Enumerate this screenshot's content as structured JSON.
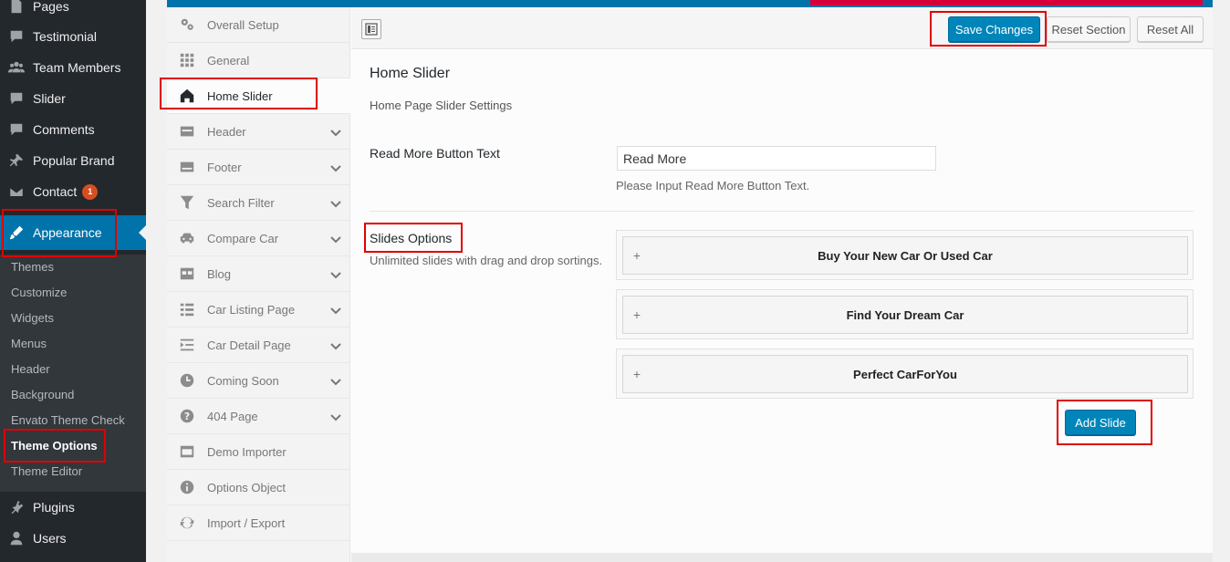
{
  "wp_menu": {
    "items": [
      {
        "label": "Pages",
        "icon": "pages-icon"
      },
      {
        "label": "Testimonial",
        "icon": "comment-icon"
      },
      {
        "label": "Team Members",
        "icon": "users-group-icon"
      },
      {
        "label": "Slider",
        "icon": "comment-icon"
      },
      {
        "label": "Comments",
        "icon": "comments-icon"
      },
      {
        "label": "Popular Brand",
        "icon": "pin-icon"
      },
      {
        "label": "Contact",
        "icon": "envelope-icon",
        "badge": "1"
      }
    ],
    "appearance": "Appearance",
    "submenu": [
      "Themes",
      "Customize",
      "Widgets",
      "Menus",
      "Header",
      "Background",
      "Envato Theme Check",
      "Theme Options",
      "Theme Editor"
    ],
    "bottom_items": [
      {
        "label": "Plugins",
        "icon": "plugin-icon"
      },
      {
        "label": "Users",
        "icon": "user-icon"
      }
    ]
  },
  "panel_nav": [
    {
      "label": "Overall Setup",
      "icon": "gears-icon",
      "chevron": false
    },
    {
      "label": "General",
      "icon": "grid-icon",
      "chevron": false
    },
    {
      "label": "Home Slider",
      "icon": "home-icon",
      "chevron": false,
      "active": true
    },
    {
      "label": "Header",
      "icon": "header-icon",
      "chevron": true
    },
    {
      "label": "Footer",
      "icon": "footer-icon",
      "chevron": true
    },
    {
      "label": "Search Filter",
      "icon": "filter-icon",
      "chevron": true
    },
    {
      "label": "Compare Car",
      "icon": "car-icon",
      "chevron": true
    },
    {
      "label": "Blog",
      "icon": "blog-icon",
      "chevron": true
    },
    {
      "label": "Car Listing Page",
      "icon": "list-icon",
      "chevron": true
    },
    {
      "label": "Car Detail Page",
      "icon": "detail-icon",
      "chevron": true
    },
    {
      "label": "Coming Soon",
      "icon": "clock-icon",
      "chevron": true
    },
    {
      "label": "404 Page",
      "icon": "question-icon",
      "chevron": true
    },
    {
      "label": "Demo Importer",
      "icon": "importer-icon",
      "chevron": false
    },
    {
      "label": "Options Object",
      "icon": "info-icon",
      "chevron": false
    },
    {
      "label": "Import / Export",
      "icon": "refresh-icon",
      "chevron": false
    }
  ],
  "toolbar": {
    "save_label": "Save Changes",
    "reset_section_label": "Reset Section",
    "reset_all_label": "Reset All"
  },
  "section": {
    "title": "Home Slider",
    "description": "Home Page Slider Settings"
  },
  "read_more": {
    "title": "Read More Button Text",
    "value": "Read More",
    "help": "Please Input Read More Button Text."
  },
  "slides": {
    "title": "Slides Options",
    "subtitle": "Unlimited slides with drag and drop sortings.",
    "items": [
      "Buy Your New Car Or Used Car",
      "Find Your Dream Car",
      "Perfect CarForYou"
    ],
    "add_label": "Add Slide"
  },
  "colors": {
    "wp_sidebar": "#23282d",
    "accent": "#0073aa",
    "primary_button": "#0085ba",
    "highlight": "#e00000"
  }
}
